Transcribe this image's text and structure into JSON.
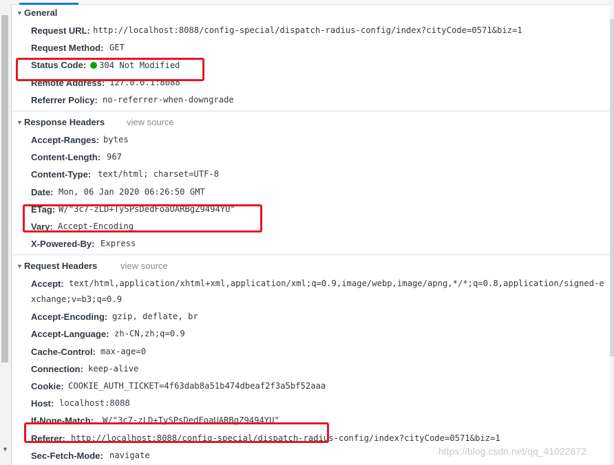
{
  "general": {
    "title": "General",
    "rows": [
      {
        "key": "Request URL:",
        "value": "http://localhost:8088/config-special/dispatch-radius-config/index?cityCode=0571&biz=1"
      },
      {
        "key": "Request Method:",
        "value": "GET"
      },
      {
        "key": "Status Code:",
        "value": "304 Not Modified"
      },
      {
        "key": "Remote Address:",
        "value": "127.0.0.1:8088"
      },
      {
        "key": "Referrer Policy:",
        "value": "no-referrer-when-downgrade"
      }
    ]
  },
  "response_headers": {
    "title": "Response Headers",
    "view_source": "view source",
    "rows": [
      {
        "key": "Accept-Ranges:",
        "value": "bytes"
      },
      {
        "key": "Content-Length:",
        "value": "967"
      },
      {
        "key": "Content-Type:",
        "value": "text/html; charset=UTF-8"
      },
      {
        "key": "Date:",
        "value": "Mon, 06 Jan 2020 06:26:50 GMT"
      },
      {
        "key": "ETag:",
        "value": "W/\"3c7-zLD+TySPsDedFoaUARBgZ9494YU\""
      },
      {
        "key": "Vary:",
        "value": "Accept-Encoding"
      },
      {
        "key": "X-Powered-By:",
        "value": "Express"
      }
    ]
  },
  "request_headers": {
    "title": "Request Headers",
    "view_source": "view source",
    "rows": [
      {
        "key": "Accept:",
        "value": "text/html,application/xhtml+xml,application/xml;q=0.9,image/webp,image/apng,*/*;q=0.8,application/signed-e",
        "value2": "xchange;v=b3;q=0.9"
      },
      {
        "key": "Accept-Encoding:",
        "value": "gzip, deflate, br"
      },
      {
        "key": "Accept-Language:",
        "value": "zh-CN,zh;q=0.9"
      },
      {
        "key": "Cache-Control:",
        "value": "max-age=0"
      },
      {
        "key": "Connection:",
        "value": "keep-alive"
      },
      {
        "key": "Cookie:",
        "value": "COOKIE_AUTH_TICKET=4f63dab8a51b474dbeaf2f3a5bf52aaa"
      },
      {
        "key": "Host:",
        "value": "localhost:8088"
      },
      {
        "key": "If-None-Match:",
        "value": "W/\"3c7-zLD+TySPsDedFoaUARBgZ9494YU\""
      },
      {
        "key": "Referer:",
        "value": "http://localhost:8088/config-special/dispatch-radius-config/index?cityCode=0571&biz=1"
      },
      {
        "key": "Sec-Fetch-Mode:",
        "value": "navigate"
      }
    ]
  },
  "watermark": "https://blog.csdn.net/qq_41022872",
  "colors": {
    "highlight": "#e8161e",
    "status_ok": "#0ca30c",
    "tab_accent": "#1a73e8"
  }
}
